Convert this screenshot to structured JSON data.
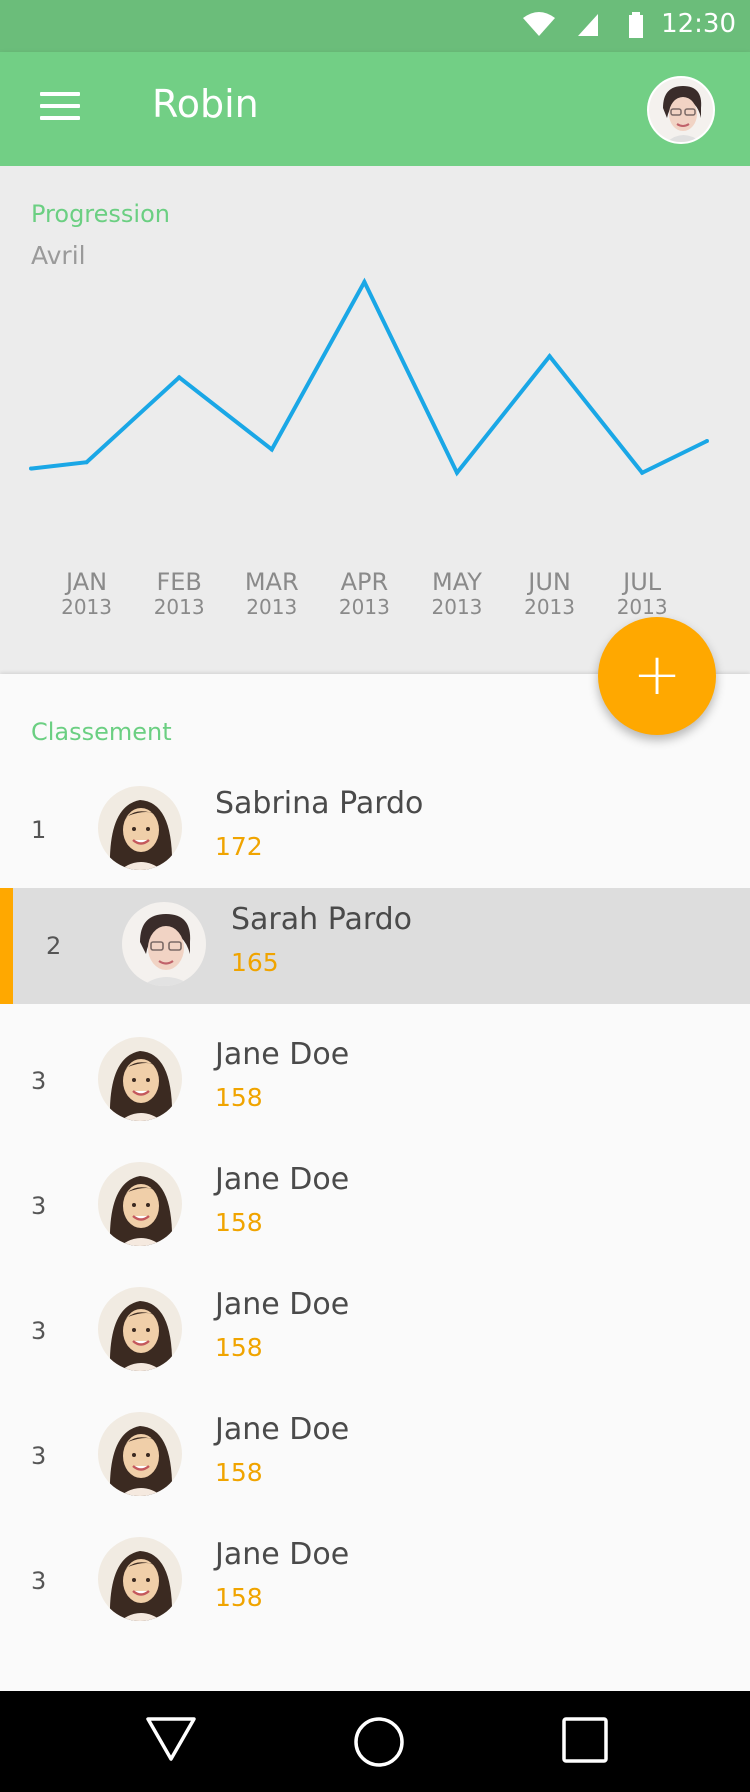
{
  "status_bar": {
    "time": "12:30",
    "icons": [
      "wifi-icon",
      "signal-icon",
      "battery-icon"
    ]
  },
  "app_bar": {
    "title": "Robin",
    "menu_icon": "hamburger-menu-icon",
    "avatar": "profile-avatar"
  },
  "chart_section": {
    "title": "Progression",
    "subtitle": "Avril"
  },
  "chart_data": {
    "type": "line",
    "title": "Progression",
    "subtitle": "Avril",
    "categories": [
      "JAN\n2013",
      "FEB\n2013",
      "MAR\n2013",
      "APR\n2013",
      "MAY\n2013",
      "JUN\n2013",
      "JUL\n2013"
    ],
    "category_month": [
      "JAN",
      "FEB",
      "MAR",
      "APR",
      "MAY",
      "JUN",
      "JUL"
    ],
    "category_year": [
      "2013",
      "2013",
      "2013",
      "2013",
      "2013",
      "2013",
      "2013"
    ],
    "series": [
      {
        "x": [
          0,
          0.6,
          1.6,
          2.6,
          3.6,
          4.6,
          5.6,
          6.6,
          7.3
        ],
        "values": [
          12,
          15,
          55,
          21,
          100,
          10,
          65,
          10,
          25
        ]
      }
    ],
    "ylim": [
      0,
      100
    ],
    "grid": false,
    "line_color": "#1aa7e6"
  },
  "fab": {
    "label": "+",
    "color": "#ffa800"
  },
  "leaderboard": {
    "title": "Classement",
    "rows": [
      {
        "rank": "1",
        "name": "Sabrina Pardo",
        "score": "172",
        "avatar": "woman-avatar",
        "selected": false
      },
      {
        "rank": "2",
        "name": "Sarah Pardo",
        "score": "165",
        "avatar": "glasses-avatar",
        "selected": true
      },
      {
        "rank": "3",
        "name": "Jane Doe",
        "score": "158",
        "avatar": "woman-avatar",
        "selected": false
      },
      {
        "rank": "3",
        "name": "Jane Doe",
        "score": "158",
        "avatar": "woman-avatar",
        "selected": false
      },
      {
        "rank": "3",
        "name": "Jane Doe",
        "score": "158",
        "avatar": "woman-avatar",
        "selected": false
      },
      {
        "rank": "3",
        "name": "Jane Doe",
        "score": "158",
        "avatar": "woman-avatar",
        "selected": false
      },
      {
        "rank": "3",
        "name": "Jane Doe",
        "score": "158",
        "avatar": "woman-avatar",
        "selected": false
      }
    ]
  },
  "nav_bar": {
    "buttons": [
      "back-triangle-icon",
      "home-circle-icon",
      "recents-square-icon"
    ]
  },
  "colors": {
    "primary": "#72cf85",
    "accent": "#ffa800",
    "chart_line": "#1aa7e6",
    "label_green": "#6bcf82"
  }
}
